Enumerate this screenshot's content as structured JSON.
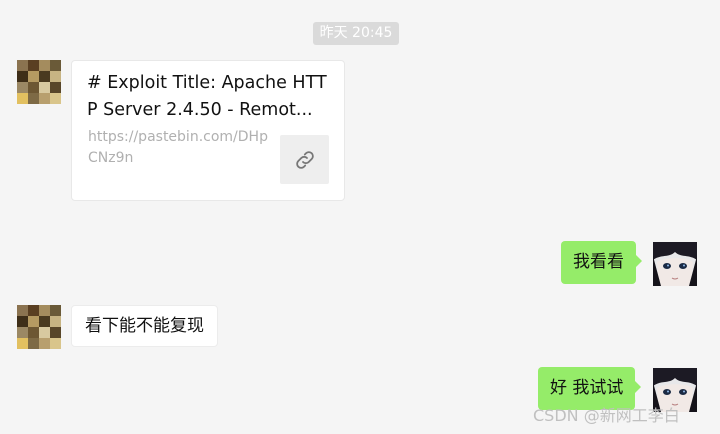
{
  "chat": {
    "timestamp": "昨天 20:45",
    "link_card": {
      "title": "# Exploit Title: Apache HTTP Server 2.4.50 - Remot...",
      "url": "https://pastebin.com/DHpCNz9n",
      "icon": "link-icon"
    },
    "messages": [
      {
        "side": "right",
        "text": "我看看"
      },
      {
        "side": "left",
        "text": "看下能不能复现"
      },
      {
        "side": "right",
        "text": "好 我试试"
      }
    ]
  },
  "watermark": "CSDN @新网工李白",
  "colors": {
    "background": "#f5f5f5",
    "outgoing_bubble": "#95ec69",
    "incoming_bubble": "#ffffff",
    "timestamp_bg": "#dadada"
  }
}
